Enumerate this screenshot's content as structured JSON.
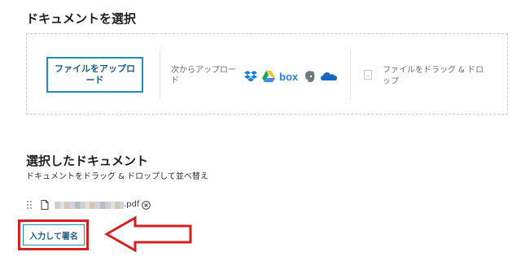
{
  "select_section": {
    "title": "ドキュメントを選択",
    "upload_button": "ファイルをアップロード",
    "from_label": "次からアップロード",
    "services": [
      "dropbox-icon",
      "google-drive-icon",
      "box-icon",
      "evernote-icon",
      "onedrive-icon"
    ],
    "drag_hint": "ファイルをドラッグ & ドロップ"
  },
  "selected_section": {
    "title": "選択したドキュメント",
    "subtitle": "ドキュメントをドラッグ & ドロップして並べ替え",
    "file": {
      "extension": ".pdf"
    }
  },
  "actions": {
    "sign_button": "入力して署名"
  },
  "colors": {
    "accent": "#1e8fb8",
    "annotation": "#d42020"
  }
}
